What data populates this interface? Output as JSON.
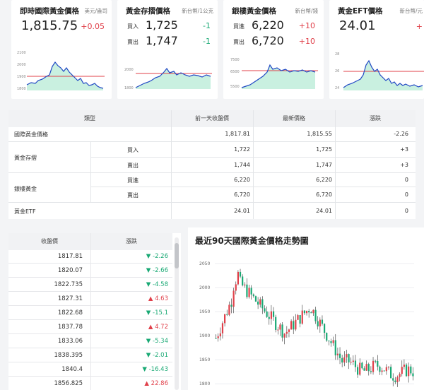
{
  "cards": [
    {
      "title": "即時國際黃金價格",
      "unit": "美元/盎司",
      "price": "1,815.75",
      "change": "+0.05",
      "y_ticks": [
        "2100",
        "2000",
        "1900",
        "1800"
      ]
    },
    {
      "title": "黃金存摺價格",
      "unit": "新台幣/1公克",
      "buy_label": "買入",
      "buy": "1,725",
      "buy_chg": "-1",
      "sell_label": "賣出",
      "sell": "1,747",
      "sell_chg": "-1",
      "y_ticks": [
        "2000",
        "1800"
      ]
    },
    {
      "title": "銀樓黃金價格",
      "unit": "新台幣/錢",
      "buy_label": "買進",
      "buy": "6,220",
      "buy_chg": "+10",
      "sell_label": "賣出",
      "sell": "6,720",
      "sell_chg": "+10",
      "y_ticks": [
        "7500",
        "6500",
        "5500"
      ]
    },
    {
      "title": "黃金EFT價格",
      "unit": "新台幣/元",
      "price": "24.01",
      "change": "+",
      "y_ticks": [
        "28",
        "26",
        "24"
      ]
    }
  ],
  "table": {
    "headers": [
      "類型",
      "前一天收盤價",
      "最新價格",
      "漲跌"
    ],
    "rows": [
      {
        "cat": "國際黃金價格",
        "sub": "",
        "prev": "1,817.81",
        "last": "1,815.55",
        "chg": "-2.26",
        "dir": "down"
      },
      {
        "cat": "黃金存摺",
        "sub": "買入",
        "prev": "1,722",
        "last": "1,725",
        "chg": "+3",
        "dir": "up"
      },
      {
        "cat": "",
        "sub": "賣出",
        "prev": "1,744",
        "last": "1,747",
        "chg": "+3",
        "dir": "up"
      },
      {
        "cat": "銀樓黃金",
        "sub": "買進",
        "prev": "6,220",
        "last": "6,220",
        "chg": "0",
        "dir": "zero"
      },
      {
        "cat": "",
        "sub": "賣出",
        "prev": "6,720",
        "last": "6,720",
        "chg": "0",
        "dir": "zero"
      },
      {
        "cat": "黃金ETF",
        "sub": "",
        "prev": "24.01",
        "last": "24.01",
        "chg": "0",
        "dir": "zero"
      }
    ]
  },
  "history": {
    "headers": [
      "收盤價",
      "漲跌"
    ],
    "rows": [
      {
        "close": "1817.81",
        "chg": "▼ -2.26",
        "dir": "down"
      },
      {
        "close": "1820.07",
        "chg": "▼ -2.66",
        "dir": "down"
      },
      {
        "close": "1822.735",
        "chg": "▼ -4.58",
        "dir": "down"
      },
      {
        "close": "1827.31",
        "chg": "▲ 4.63",
        "dir": "up"
      },
      {
        "close": "1822.68",
        "chg": "▼ -15.1",
        "dir": "down"
      },
      {
        "close": "1837.78",
        "chg": "▲ 4.72",
        "dir": "up"
      },
      {
        "close": "1833.06",
        "chg": "▼ -5.34",
        "dir": "down"
      },
      {
        "close": "1838.395",
        "chg": "▼ -2.01",
        "dir": "down"
      },
      {
        "close": "1840.4",
        "chg": "▼ -16.43",
        "dir": "down"
      },
      {
        "close": "1856.825",
        "chg": "▲ 22.86",
        "dir": "up"
      }
    ]
  },
  "candle_chart": {
    "title": "最近90天國際黃金價格走勢圖",
    "y_ticks": [
      "2050",
      "2000",
      "1950",
      "1900",
      "1850",
      "1800"
    ],
    "ylim": [
      1790,
      2075
    ]
  },
  "colors": {
    "up": "#e0404a",
    "down": "#19a974",
    "area": "#c9f0e0",
    "line": "#1f47c4",
    "ref": "#e0404a"
  }
}
